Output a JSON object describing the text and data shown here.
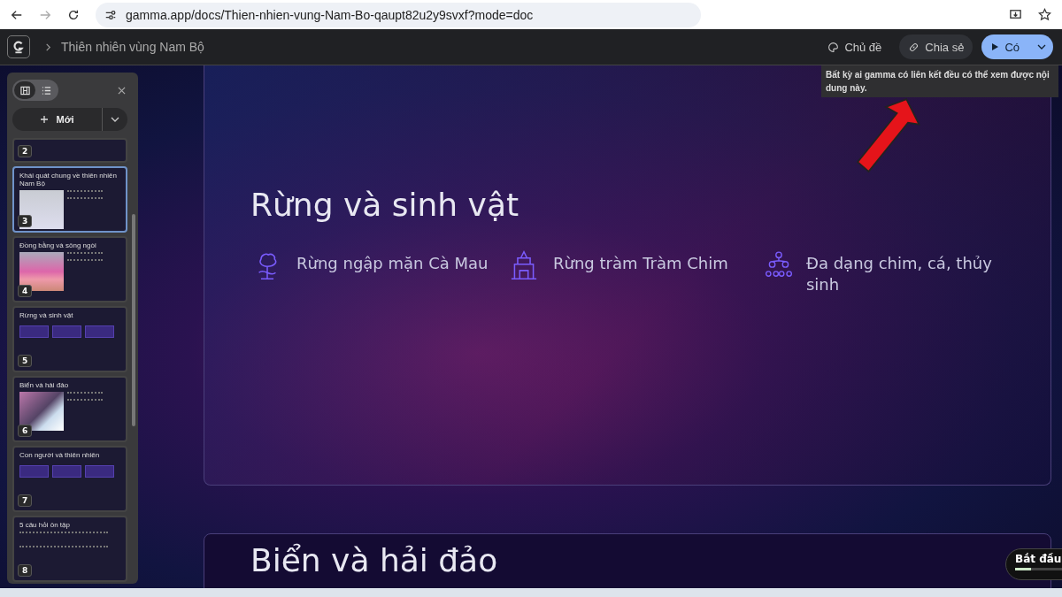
{
  "browser": {
    "url": "gamma.app/docs/Thien-nhien-vung-Nam-Bo-qaupt82u2y9svxf?mode=doc"
  },
  "header": {
    "doc_title": "Thiên nhiên vùng Nam Bộ",
    "theme_button": "Chủ đề",
    "share_button": "Chia sẻ",
    "present_button": "Có"
  },
  "tooltip": "Bất kỳ ai gamma có liên kết đều có thể xem được nội dung này.",
  "sidebar": {
    "view_toggle": [
      {
        "kind": "cards",
        "selected": true
      },
      {
        "kind": "list",
        "selected": false
      }
    ],
    "new_button": "Mới",
    "slides": [
      {
        "number": "2",
        "kind": "partial",
        "selected": false
      },
      {
        "number": "3",
        "kind": "image",
        "title": "Khái quát chung về thiên nhiên Nam Bộ",
        "selected": true
      },
      {
        "number": "4",
        "kind": "image",
        "title": "Đồng bằng và sông ngòi",
        "selected": false
      },
      {
        "number": "5",
        "kind": "cards",
        "title": "Rừng và sinh vật",
        "selected": false
      },
      {
        "number": "6",
        "kind": "image",
        "title": "Biển và hải đảo",
        "selected": false
      },
      {
        "number": "7",
        "kind": "cards",
        "title": "Con người và thiên nhiên",
        "selected": false
      },
      {
        "number": "8",
        "kind": "list",
        "title": "5 câu hỏi ôn tập",
        "selected": false
      }
    ]
  },
  "cards": [
    {
      "title": "Rừng và sinh vật",
      "features": [
        {
          "kind": "tree",
          "text": "Rừng ngập mặn Cà Mau"
        },
        {
          "kind": "temple",
          "text": "Rừng tràm Tràm Chim"
        },
        {
          "kind": "network",
          "text": "Đa dạng chim, cá, thủy sinh"
        }
      ]
    },
    {
      "title": "Biển và hải đảo"
    }
  ],
  "start_pill": {
    "label": "Bắt đầu",
    "level": 0.3
  }
}
